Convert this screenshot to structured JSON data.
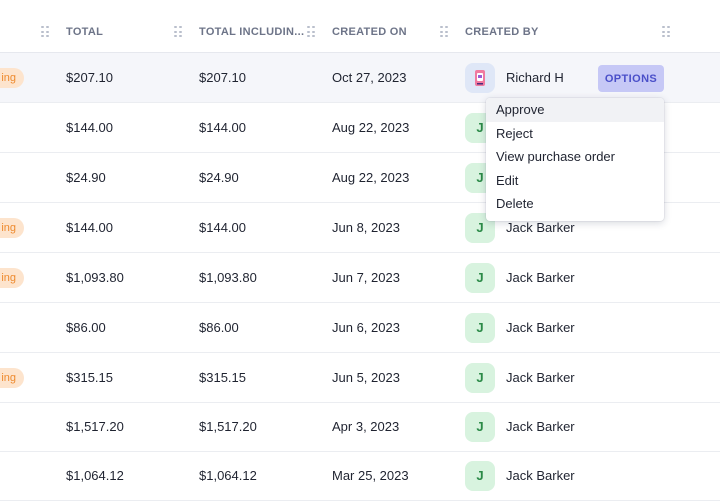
{
  "columns": [
    {
      "label": "TOTAL"
    },
    {
      "label": "TOTAL INCLUDIN..."
    },
    {
      "label": "CREATED ON"
    },
    {
      "label": "CREATED BY"
    }
  ],
  "rows": [
    {
      "status": "ing",
      "total": "$207.10",
      "total_incl": "$207.10",
      "created_on": "Oct 27, 2023",
      "avatar": "",
      "created_by": "Richard H"
    },
    {
      "status": "",
      "total": "$144.00",
      "total_incl": "$144.00",
      "created_on": "Aug 22, 2023",
      "avatar": "J",
      "created_by": ""
    },
    {
      "status": "",
      "total": "$24.90",
      "total_incl": "$24.90",
      "created_on": "Aug 22, 2023",
      "avatar": "J",
      "created_by": ""
    },
    {
      "status": "ing",
      "total": "$144.00",
      "total_incl": "$144.00",
      "created_on": "Jun 8, 2023",
      "avatar": "J",
      "created_by": "Jack Barker"
    },
    {
      "status": "ing",
      "total": "$1,093.80",
      "total_incl": "$1,093.80",
      "created_on": "Jun 7, 2023",
      "avatar": "J",
      "created_by": "Jack Barker"
    },
    {
      "status": "",
      "total": "$86.00",
      "total_incl": "$86.00",
      "created_on": "Jun 6, 2023",
      "avatar": "J",
      "created_by": "Jack Barker"
    },
    {
      "status": "ing",
      "total": "$315.15",
      "total_incl": "$315.15",
      "created_on": "Jun 5, 2023",
      "avatar": "J",
      "created_by": "Jack Barker"
    },
    {
      "status": "",
      "total": "$1,517.20",
      "total_incl": "$1,517.20",
      "created_on": "Apr 3, 2023",
      "avatar": "J",
      "created_by": "Jack Barker"
    },
    {
      "status": "",
      "total": "$1,064.12",
      "total_incl": "$1,064.12",
      "created_on": "Mar 25, 2023",
      "avatar": "J",
      "created_by": "Jack Barker"
    }
  ],
  "options_label": "OPTIONS",
  "menu": [
    "Approve",
    "Reject",
    "View purchase order",
    "Edit",
    "Delete"
  ],
  "colors": {
    "accent": "#c6c8f6",
    "accent_text": "#4a4fc9",
    "status_bg": "#fde4cd",
    "status_text": "#ee8a2e",
    "avatar_bg": "#d8f3df",
    "avatar_text": "#2b8a47"
  },
  "icons": {
    "column_drag": "drag-handle-icon",
    "user_photo": "user-photo-avatar"
  }
}
